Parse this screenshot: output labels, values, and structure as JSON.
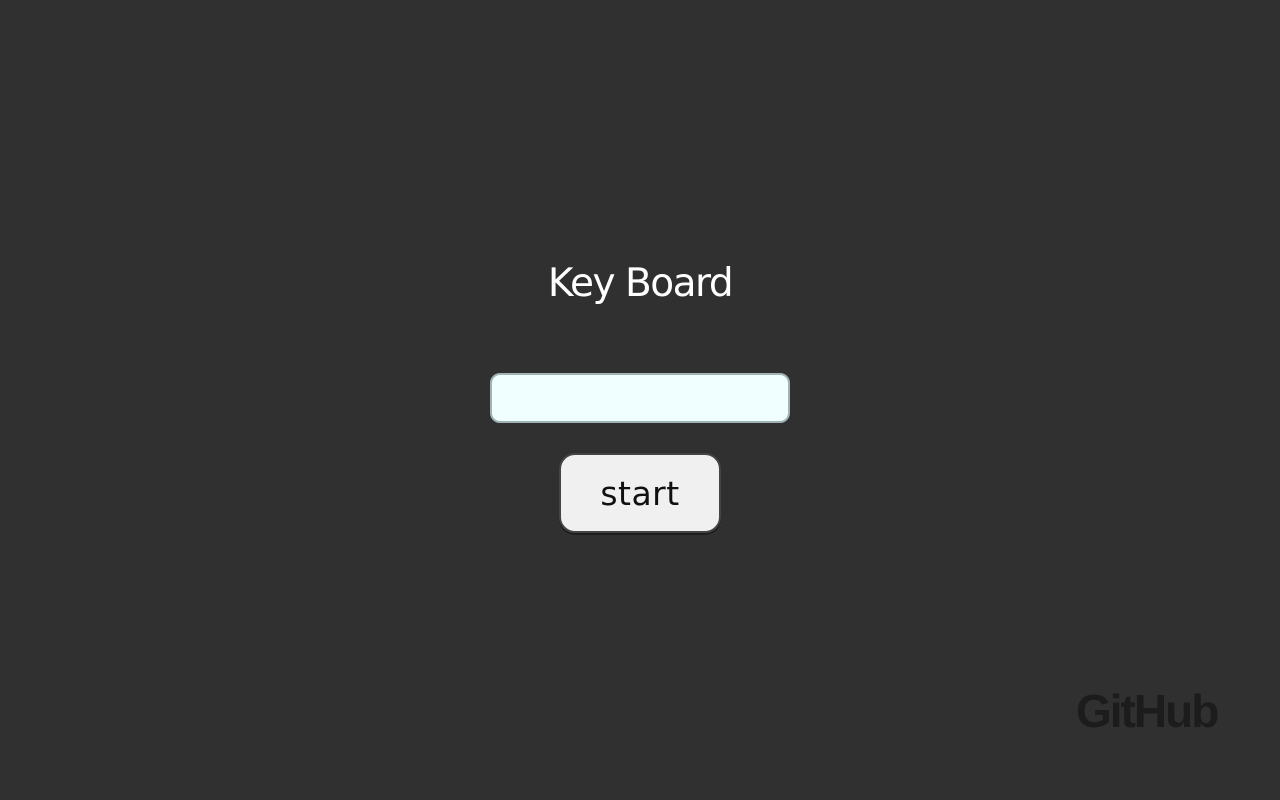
{
  "page": {
    "title": "Key Board"
  },
  "form": {
    "input_value": "",
    "input_placeholder": "",
    "start_label": "start"
  },
  "footer": {
    "github_label": "GitHub"
  },
  "colors": {
    "background": "#303030",
    "title_text": "#ffffff",
    "input_background": "#f0ffff",
    "button_background": "#f0f0f0",
    "github_logo": "#1c1c1c"
  }
}
